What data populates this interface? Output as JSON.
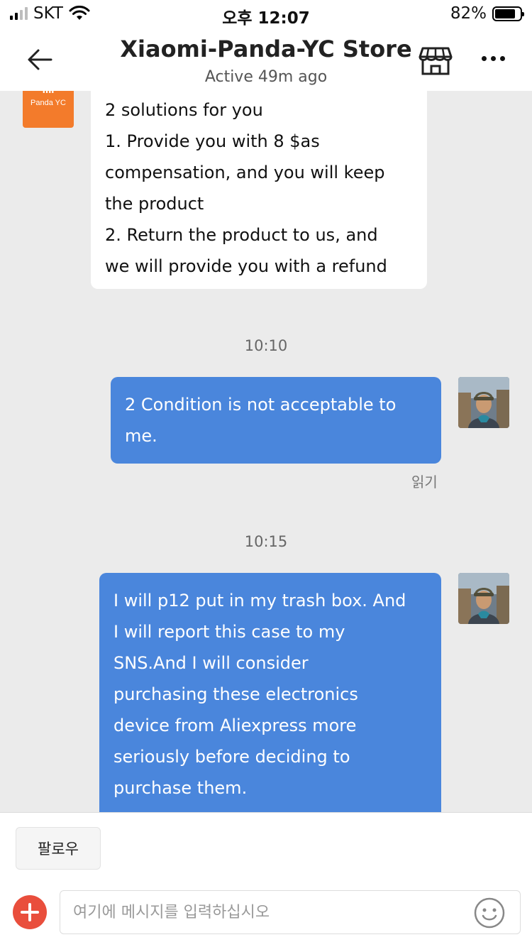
{
  "status_bar": {
    "carrier": "SKT",
    "time": "오후 12:07",
    "battery_percent": "82%",
    "battery_level": 0.82
  },
  "header": {
    "title": "Xiaomi-Panda-YC Store",
    "subtitle": "Active 49m ago",
    "icons": [
      "back-arrow-icon",
      "store-icon",
      "more-icon"
    ]
  },
  "store_avatar": {
    "label": "Panda YC",
    "logo_text": "mi"
  },
  "messages": [
    {
      "from": "store",
      "lines": [
        "2 solutions for you",
        "1. Provide you with 8 $as",
        "compensation, and you will keep",
        "the product",
        "2. Return the product to us, and",
        "we will provide you with a refund"
      ]
    },
    {
      "type": "timestamp",
      "text": "10:10"
    },
    {
      "from": "me",
      "lines": [
        " 2 Condition is not acceptable to",
        "me."
      ],
      "read_label": "읽기"
    },
    {
      "type": "timestamp",
      "text": "10:15"
    },
    {
      "from": "me",
      "lines": [
        "I will p12 put in my trash box. And",
        "I will report this case to my",
        "SNS.And I will consider",
        "purchasing these electronics",
        "device from Aliexpress more",
        "seriously before deciding to",
        "purchase them."
      ]
    }
  ],
  "bottom": {
    "follow_label": "팔로우",
    "input_placeholder": "여기에 메시지를 입력하십시오",
    "input_value": ""
  },
  "colors": {
    "accent_blue": "#4a86dc",
    "store_orange": "#f37b2b",
    "add_red": "#e94e3c",
    "chat_bg": "#ebebeb"
  }
}
